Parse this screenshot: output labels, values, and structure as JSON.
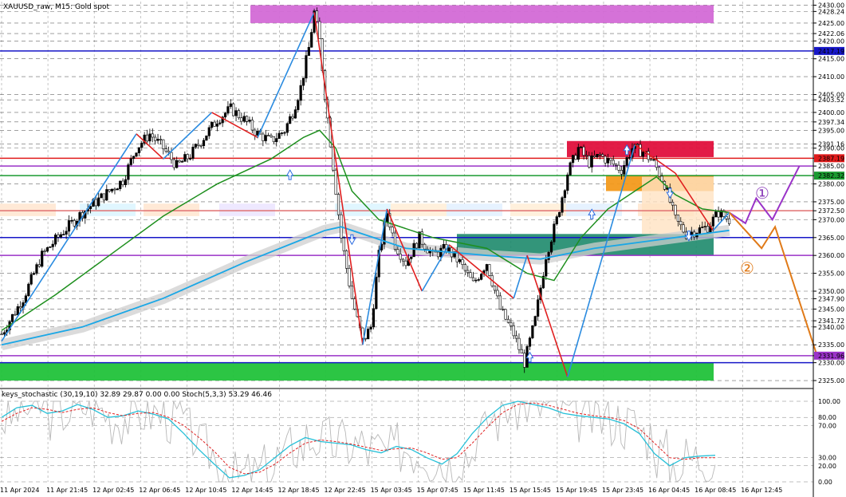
{
  "header": {
    "symbol_title": "XAUUSD_raw, M15:  Gold spot"
  },
  "indicator": {
    "label": "keys_stochastic (30,19,10) 32.89 29.87 0.00 0.00 Stoch(5,3,3) 53.29 46.46"
  },
  "annotations": {
    "scenario_1": "①",
    "scenario_2": "②"
  },
  "colors": {
    "bull_body": "#000000",
    "bear_body": "#ffffff",
    "ema_fast": "#1e8f1e",
    "ema_slow": "#1aa7e6",
    "zigzag_up": "#2a8be0",
    "zigzag_down": "#e02020",
    "supply_top": "#d36ad6",
    "supply_mid": "#e0103c",
    "demand_green": "#21c23a",
    "teal_zone": "#1d8a6b",
    "orange_zone": "#f39a1c",
    "purple_line": "#9a33c8",
    "blue_line": "#1616c8",
    "red_line": "#e01b1b",
    "green_line": "#1a9a30"
  },
  "chart_data": [
    {
      "type": "candlestick",
      "title": "XAUUSD_raw, M15:  Gold spot",
      "ylim": [
        2323,
        2431
      ],
      "x_tick_labels": [
        "11 Apr 2024",
        "11 Apr 21:45",
        "12 Apr 02:45",
        "12 Apr 06:45",
        "12 Apr 10:45",
        "12 Apr 14:45",
        "12 Apr 18:45",
        "12 Apr 22:45",
        "15 Apr 03:45",
        "15 Apr 07:45",
        "15 Apr 11:45",
        "15 Apr 15:45",
        "15 Apr 19:45",
        "15 Apr 23:45",
        "16 Apr 04:45",
        "16 Apr 08:45",
        "16 Apr 12:45"
      ],
      "y_tick_labels": [
        "2430.00",
        "2428.24",
        "2425.00",
        "2422.06",
        "2420.00",
        "2417.19",
        "2415.00",
        "2410.00",
        "2405.00",
        "2403.52",
        "2400.00",
        "2397.34",
        "2395.00",
        "2391.16",
        "2390.00",
        "2387.19",
        "2385.00",
        "2382.32",
        "2380.00",
        "2375.00",
        "2372.50",
        "2370.00",
        "2365.00",
        "2360.00",
        "2355.00",
        "2350.00",
        "2347.90",
        "2345.00",
        "2341.72",
        "2340.00",
        "2335.00",
        "2331.96",
        "2330.00",
        "2325.00"
      ],
      "highlight_prices": [
        {
          "label": "2417.19",
          "value": 2417.19,
          "color": "#1616c8"
        },
        {
          "label": "2387.19",
          "value": 2387.19,
          "color": "#e01b1b"
        },
        {
          "label": "2382.32",
          "value": 2382.32,
          "color": "#1a9a30"
        },
        {
          "label": "2331.96",
          "value": 2331.96,
          "color": "#9a33c8"
        }
      ],
      "horizontal_levels": [
        2417.19,
        2387.19,
        2385.0,
        2382.32,
        2372.5,
        2365.0,
        2360.0,
        2331.96,
        2330.0
      ],
      "zones": [
        {
          "name": "supply-top",
          "from": 2425,
          "to": 2430,
          "color": "#d36ad6"
        },
        {
          "name": "supply-mid",
          "from": 2387.5,
          "to": 2392,
          "color": "#e0103c"
        },
        {
          "name": "orange",
          "from": 2378,
          "to": 2382.5,
          "color": "#f39a1c"
        },
        {
          "name": "teal",
          "from": 2360,
          "to": 2366,
          "color": "#1d8a6b"
        },
        {
          "name": "demand-green",
          "from": 2325,
          "to": 2330,
          "color": "#21c23a"
        }
      ],
      "close_path": [
        [
          0,
          2338
        ],
        [
          8,
          2348
        ],
        [
          15,
          2360
        ],
        [
          22,
          2366
        ],
        [
          30,
          2372
        ],
        [
          35,
          2375
        ],
        [
          40,
          2378
        ],
        [
          45,
          2381
        ],
        [
          50,
          2390
        ],
        [
          55,
          2394
        ],
        [
          60,
          2390
        ],
        [
          65,
          2385
        ],
        [
          70,
          2388
        ],
        [
          75,
          2393
        ],
        [
          80,
          2398
        ],
        [
          85,
          2401
        ],
        [
          90,
          2398
        ],
        [
          95,
          2394
        ],
        [
          100,
          2392
        ],
        [
          105,
          2395
        ],
        [
          108,
          2400
        ],
        [
          111,
          2407
        ],
        [
          114,
          2418
        ],
        [
          116,
          2428
        ],
        [
          118,
          2420
        ],
        [
          120,
          2405
        ],
        [
          123,
          2385
        ],
        [
          126,
          2365
        ],
        [
          130,
          2348
        ],
        [
          134,
          2336
        ],
        [
          137,
          2340
        ],
        [
          140,
          2360
        ],
        [
          143,
          2372
        ],
        [
          146,
          2363
        ],
        [
          150,
          2358
        ],
        [
          155,
          2365
        ],
        [
          160,
          2360
        ],
        [
          165,
          2362
        ],
        [
          170,
          2358
        ],
        [
          175,
          2352
        ],
        [
          180,
          2358
        ],
        [
          185,
          2345
        ],
        [
          190,
          2338
        ],
        [
          194,
          2330
        ],
        [
          198,
          2342
        ],
        [
          202,
          2360
        ],
        [
          206,
          2370
        ],
        [
          210,
          2383
        ],
        [
          214,
          2390
        ],
        [
          218,
          2386
        ],
        [
          222,
          2388
        ],
        [
          226,
          2386
        ],
        [
          230,
          2384
        ],
        [
          234,
          2390
        ],
        [
          238,
          2389
        ],
        [
          242,
          2386
        ],
        [
          246,
          2380
        ],
        [
          250,
          2370
        ],
        [
          254,
          2366
        ],
        [
          258,
          2367
        ],
        [
          262,
          2368
        ],
        [
          266,
          2372
        ],
        [
          270,
          2370
        ]
      ],
      "ema_fast_path": [
        [
          0,
          2339
        ],
        [
          20,
          2349
        ],
        [
          40,
          2360
        ],
        [
          60,
          2371
        ],
        [
          80,
          2380
        ],
        [
          100,
          2387
        ],
        [
          112,
          2393
        ],
        [
          118,
          2395
        ],
        [
          124,
          2390
        ],
        [
          130,
          2378
        ],
        [
          140,
          2370
        ],
        [
          160,
          2365
        ],
        [
          180,
          2362
        ],
        [
          195,
          2355
        ],
        [
          205,
          2353
        ],
        [
          215,
          2365
        ],
        [
          225,
          2373
        ],
        [
          235,
          2378
        ],
        [
          243,
          2382
        ],
        [
          250,
          2377
        ],
        [
          260,
          2373
        ],
        [
          270,
          2372
        ]
      ],
      "ema_slow_path": [
        [
          0,
          2335
        ],
        [
          30,
          2340
        ],
        [
          60,
          2348
        ],
        [
          90,
          2358
        ],
        [
          120,
          2367
        ],
        [
          126,
          2368
        ],
        [
          150,
          2362
        ],
        [
          180,
          2360
        ],
        [
          200,
          2359
        ],
        [
          220,
          2362
        ],
        [
          240,
          2364
        ],
        [
          260,
          2366
        ],
        [
          270,
          2367
        ]
      ],
      "scenario_paths": [
        {
          "name": "scenario-1",
          "color": "#9a33c8",
          "points": [
            [
              270,
              2372
            ],
            [
              276,
              2369
            ],
            [
              280,
              2376
            ],
            [
              286,
              2370
            ],
            [
              296,
              2385
            ]
          ]
        },
        {
          "name": "scenario-2",
          "color": "#e07a18",
          "points": [
            [
              270,
              2372
            ],
            [
              282,
              2362
            ],
            [
              287,
              2368
            ],
            [
              303,
              2331
            ]
          ]
        }
      ]
    },
    {
      "type": "line",
      "title": "keys_stochastic (30,19,10) 32.89 29.87 0.00 0.00 Stoch(5,3,3) 53.29 46.46",
      "ylim": [
        0,
        100
      ],
      "y_tick_labels": [
        "100.00",
        "80.00",
        "70.00",
        "30.00",
        "20.00",
        "0.00"
      ],
      "series": [
        {
          "name": "main",
          "values": [
            80,
            92,
            95,
            85,
            88,
            96,
            90,
            80,
            82,
            88,
            84,
            78,
            60,
            40,
            22,
            5,
            8,
            15,
            30,
            45,
            55,
            50,
            48,
            46,
            40,
            36,
            44,
            40,
            30,
            22,
            35,
            60,
            80,
            95,
            100,
            96,
            92,
            85,
            82,
            80,
            78,
            72,
            60,
            35,
            20,
            30,
            32,
            33
          ]
        },
        {
          "name": "signal",
          "values": [
            75,
            85,
            92,
            90,
            86,
            90,
            92,
            86,
            82,
            85,
            86,
            80,
            70,
            55,
            38,
            18,
            10,
            12,
            22,
            36,
            48,
            52,
            50,
            47,
            43,
            39,
            41,
            42,
            36,
            28,
            30,
            48,
            68,
            86,
            96,
            98,
            95,
            90,
            85,
            82,
            80,
            76,
            66,
            48,
            30,
            28,
            30,
            30
          ]
        }
      ]
    }
  ]
}
